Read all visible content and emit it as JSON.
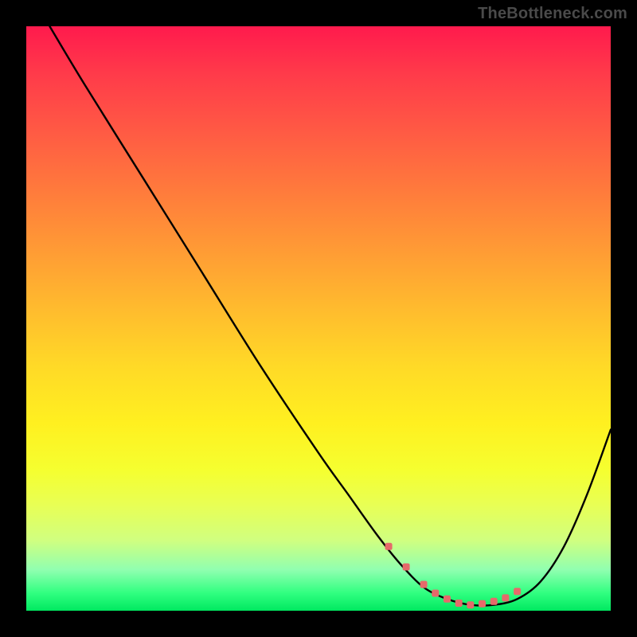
{
  "watermark": "TheBottleneck.com",
  "chart_data": {
    "type": "line",
    "title": "",
    "xlabel": "",
    "ylabel": "",
    "xlim": [
      0,
      100
    ],
    "ylim": [
      0,
      100
    ],
    "series": [
      {
        "name": "bottleneck-curve",
        "x": [
          4,
          10,
          20,
          30,
          40,
          50,
          55,
          60,
          64,
          68,
          72,
          76,
          80,
          84,
          88,
          92,
          96,
          100
        ],
        "values": [
          100,
          90,
          74,
          58,
          42,
          27,
          20,
          13,
          8,
          4,
          2,
          1,
          1,
          2,
          5,
          11,
          20,
          31
        ]
      }
    ],
    "markers": {
      "name": "highlight-points",
      "color": "#e56a6a",
      "x": [
        62,
        65,
        68,
        70,
        72,
        74,
        76,
        78,
        80,
        82,
        84
      ],
      "values": [
        11,
        7.5,
        4.5,
        3,
        2,
        1.3,
        1,
        1.2,
        1.6,
        2.2,
        3.3
      ]
    },
    "gradient_stops": [
      {
        "pos": 0,
        "color": "#ff1a4d"
      },
      {
        "pos": 50,
        "color": "#ffd927"
      },
      {
        "pos": 80,
        "color": "#f5ff30"
      },
      {
        "pos": 100,
        "color": "#00e860"
      }
    ]
  }
}
